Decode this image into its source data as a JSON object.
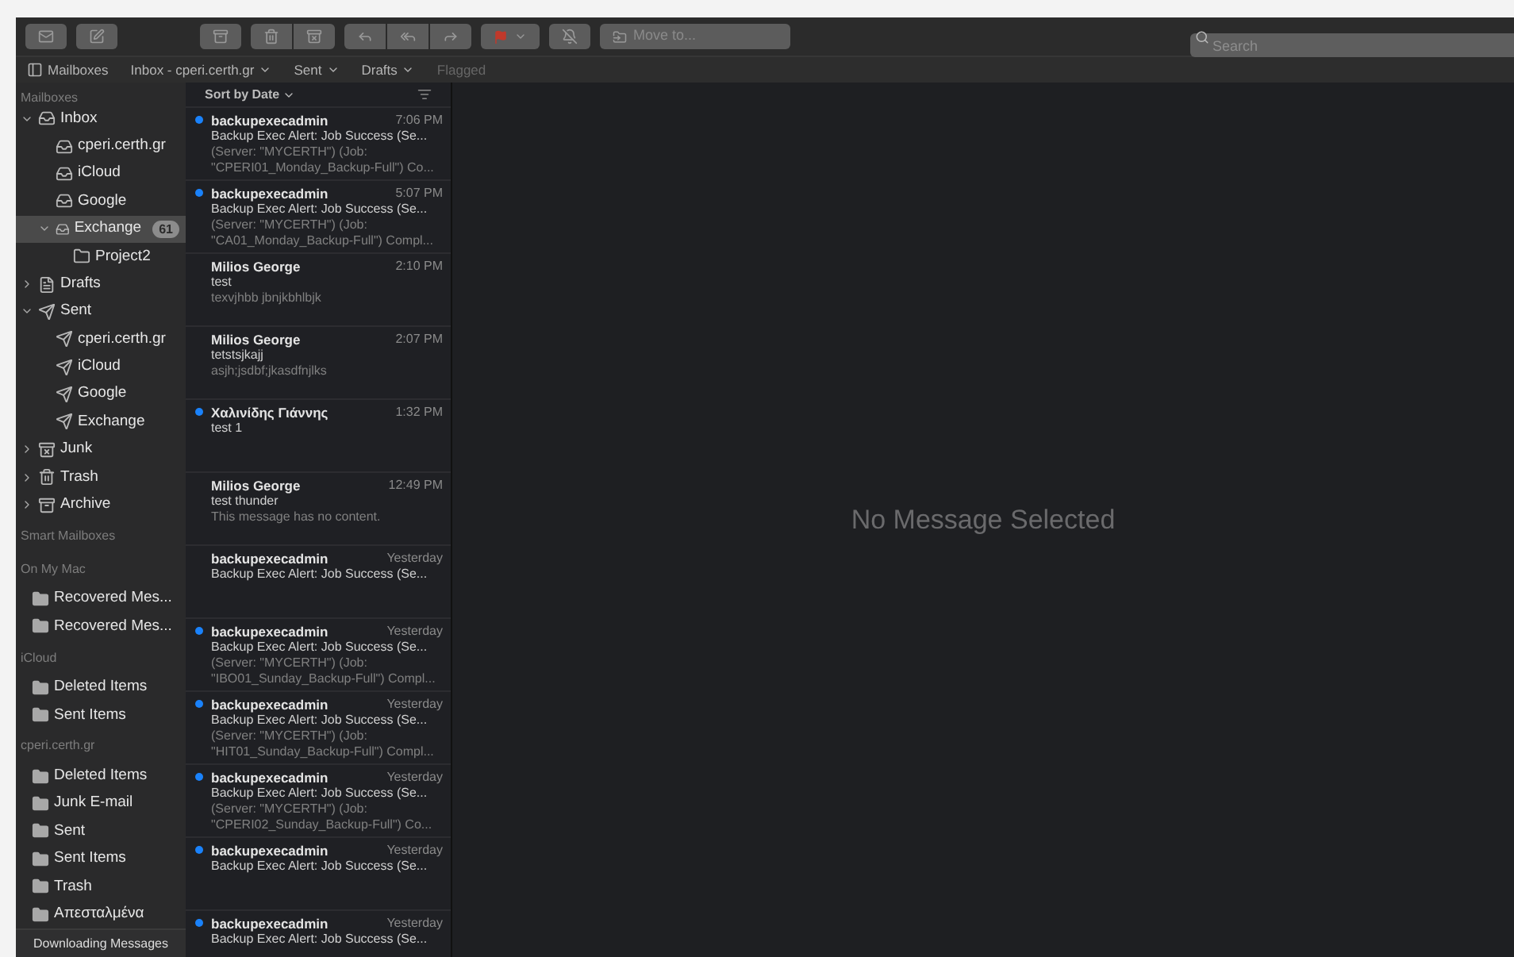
{
  "toolbar": {
    "move_to": "Move to...",
    "search": {
      "placeholder": "Search"
    }
  },
  "favorites": [
    {
      "label": "Mailboxes",
      "kind": "sidebar"
    },
    {
      "label": "Inbox - cperi.certh.gr",
      "kind": "menu"
    },
    {
      "label": "Sent",
      "kind": "menu"
    },
    {
      "label": "Drafts",
      "kind": "menu"
    },
    {
      "label": "Flagged",
      "kind": "disabled"
    }
  ],
  "sidebar": {
    "title": "Mailboxes",
    "mailboxes": [
      {
        "label": "Inbox",
        "kind": "inbox",
        "expanded": true,
        "children": [
          {
            "label": "cperi.certh.gr",
            "kind": "inbox"
          },
          {
            "label": "iCloud",
            "kind": "inbox"
          },
          {
            "label": "Google",
            "kind": "inbox"
          },
          {
            "label": "Exchange",
            "kind": "inbox",
            "expanded": true,
            "selected": true,
            "badge": "61",
            "children": [
              {
                "label": "Project2",
                "kind": "folder"
              }
            ]
          }
        ]
      },
      {
        "label": "Drafts",
        "kind": "drafts",
        "expanded": false
      },
      {
        "label": "Sent",
        "kind": "sent",
        "expanded": true,
        "children": [
          {
            "label": "cperi.certh.gr",
            "kind": "sent"
          },
          {
            "label": "iCloud",
            "kind": "sent"
          },
          {
            "label": "Google",
            "kind": "sent"
          },
          {
            "label": "Exchange",
            "kind": "sent"
          }
        ]
      },
      {
        "label": "Junk",
        "kind": "junk",
        "expanded": false
      },
      {
        "label": "Trash",
        "kind": "trash",
        "expanded": false
      },
      {
        "label": "Archive",
        "kind": "archive",
        "expanded": false
      }
    ],
    "sections": [
      {
        "title": "Smart Mailboxes"
      },
      {
        "title": "On My Mac",
        "items": [
          "Recovered Mes...",
          "Recovered Mes..."
        ]
      },
      {
        "title": "iCloud",
        "items": [
          "Deleted Items",
          "Sent Items"
        ]
      },
      {
        "title": "cperi.certh.gr",
        "items": [
          "Deleted Items",
          "Junk E-mail",
          "Sent",
          "Sent Items",
          "Trash",
          "Απεσταλμένα"
        ]
      }
    ],
    "status": "Downloading Messages"
  },
  "message_list": {
    "sort": "Sort by Date",
    "messages": [
      {
        "sender": "backupexecadmin",
        "time": "7:06 PM",
        "subject": "Backup Exec Alert: Job Success (Se...",
        "preview": [
          "(Server: \"MYCERTH\") (Job:",
          "\"CPERI01_Monday_Backup-Full\") Co..."
        ],
        "unread": true
      },
      {
        "sender": "backupexecadmin",
        "time": "5:07 PM",
        "subject": "Backup Exec Alert: Job Success (Se...",
        "preview": [
          "(Server: \"MYCERTH\") (Job:",
          "\"CA01_Monday_Backup-Full\") Compl..."
        ],
        "unread": true
      },
      {
        "sender": "Milios George",
        "time": "2:10 PM",
        "subject": "test",
        "preview": [
          "texvjhbb jbnjkbhlbjk"
        ],
        "unread": false
      },
      {
        "sender": "Milios George",
        "time": "2:07 PM",
        "subject": "tetstsjkajj",
        "preview": [
          "asjh;jsdbf;jkasdfnjlks"
        ],
        "unread": false
      },
      {
        "sender": "Χαλινίδης Γιάννης",
        "time": "1:32 PM",
        "subject": "test 1",
        "unread": true
      },
      {
        "sender": "Milios George",
        "time": "12:49 PM",
        "subject": "test thunder",
        "preview": [
          "This message has no content."
        ],
        "unread": false
      },
      {
        "sender": "backupexecadmin",
        "time": "Yesterday",
        "subject": "Backup Exec Alert: Job Success (Se...",
        "unread": false
      },
      {
        "sender": "backupexecadmin",
        "time": "Yesterday",
        "subject": "Backup Exec Alert: Job Success (Se...",
        "preview": [
          "(Server: \"MYCERTH\") (Job:",
          "\"IBO01_Sunday_Backup-Full\") Compl..."
        ],
        "unread": true
      },
      {
        "sender": "backupexecadmin",
        "time": "Yesterday",
        "subject": "Backup Exec Alert: Job Success (Se...",
        "preview": [
          "(Server: \"MYCERTH\") (Job:",
          "\"HIT01_Sunday_Backup-Full\") Compl..."
        ],
        "unread": true
      },
      {
        "sender": "backupexecadmin",
        "time": "Yesterday",
        "subject": "Backup Exec Alert: Job Success (Se...",
        "preview": [
          "(Server: \"MYCERTH\") (Job:",
          "\"CPERI02_Sunday_Backup-Full\") Co..."
        ],
        "unread": true
      },
      {
        "sender": "backupexecadmin",
        "time": "Yesterday",
        "subject": "Backup Exec Alert: Job Success (Se...",
        "unread": true
      },
      {
        "sender": "backupexecadmin",
        "time": "Yesterday",
        "subject": "Backup Exec Alert: Job Success (Se...",
        "unread": true
      }
    ]
  },
  "viewer": {
    "empty_text": "No Message Selected"
  }
}
